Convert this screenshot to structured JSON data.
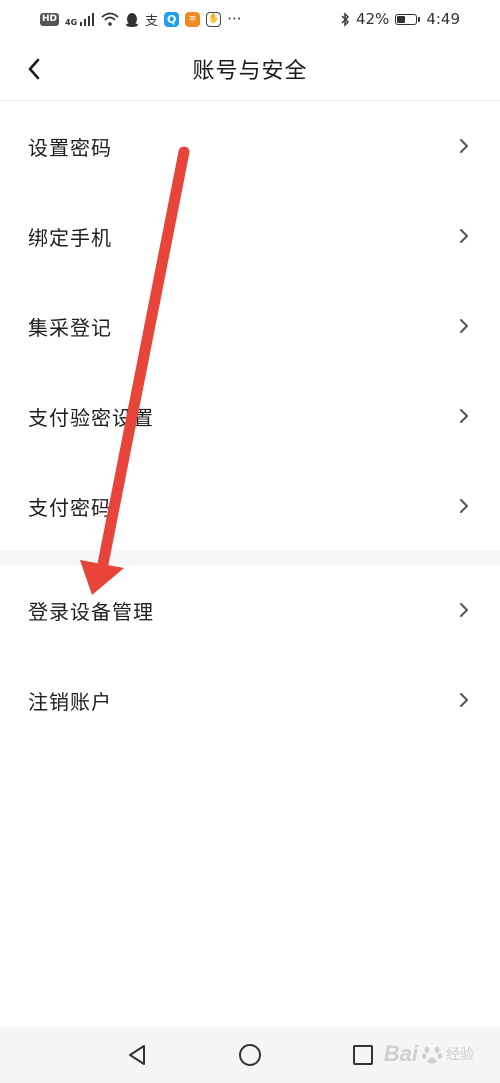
{
  "status_bar": {
    "hd": "HD",
    "network": "4G",
    "battery_percent_text": "42%",
    "battery_level": 0.42,
    "time": "4:49",
    "more": "···",
    "app_q_glyph": "Q",
    "app_b_glyph": "≡",
    "app_h_glyph": "✋",
    "alipay_glyph": "支",
    "icons": [
      "signal-icon",
      "wifi-icon",
      "qq-icon",
      "alipay-icon",
      "bluetooth-icon",
      "battery-icon"
    ]
  },
  "header": {
    "title": "账号与安全"
  },
  "menu": {
    "items": [
      {
        "label": "设置密码"
      },
      {
        "label": "绑定手机"
      },
      {
        "label": "集采登记"
      },
      {
        "label": "支付验密设置"
      },
      {
        "label": "支付密码"
      },
      {
        "label": "登录设备管理"
      },
      {
        "label": "注销账户"
      }
    ]
  },
  "colors": {
    "annotation_arrow": "#e8443a",
    "section_gap": "#f6f7f9",
    "nav_bar": "#f5f5f5"
  },
  "watermark": {
    "brand": "Bai",
    "text": "经验"
  }
}
